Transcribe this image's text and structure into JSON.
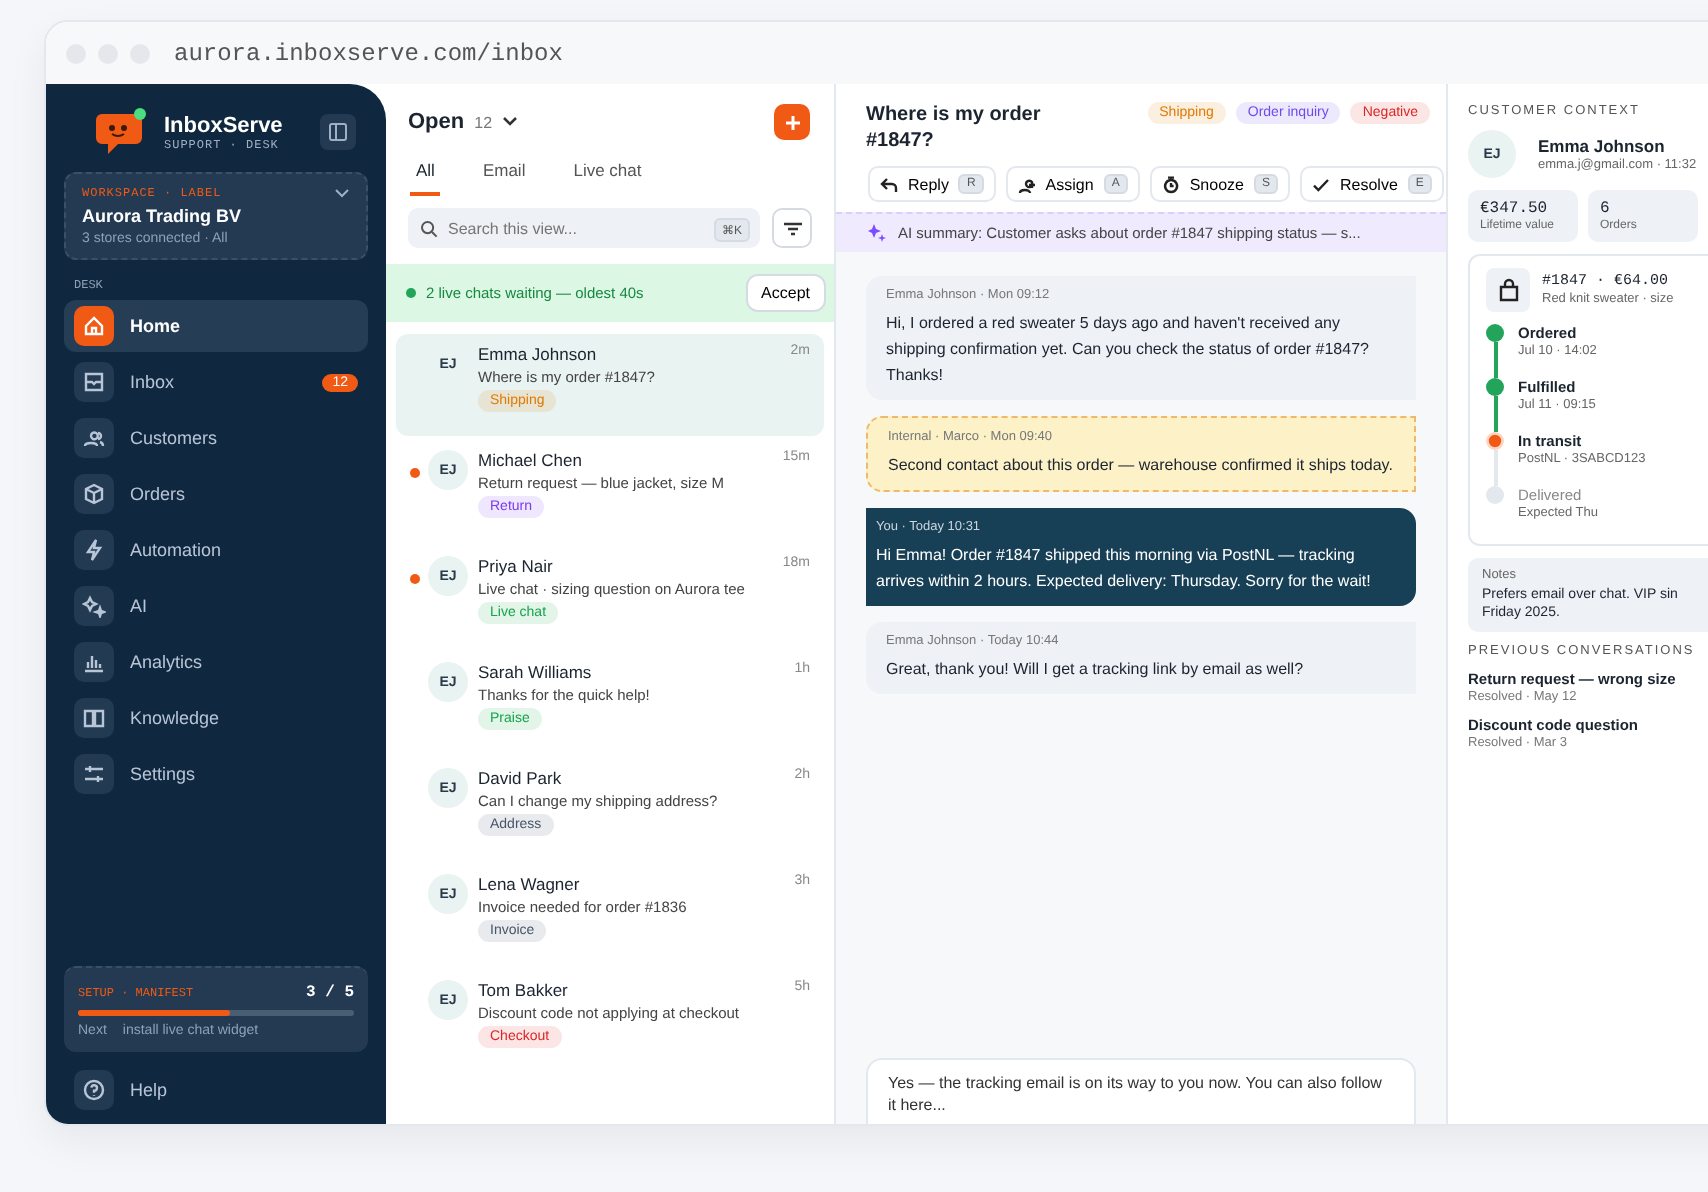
{
  "browser": {
    "url": "aurora.inboxserve.com/inbox"
  },
  "sidebar": {
    "brand": "InboxServe",
    "brand_sub": "SUPPORT · DESK",
    "workspace": {
      "label": "WORKSPACE · LABEL",
      "name": "Aurora Trading BV",
      "detail": "3 stores connected · All"
    },
    "section": "DESK",
    "items": [
      {
        "label": "Home",
        "selected": true
      },
      {
        "label": "Inbox",
        "selected": false,
        "badge": "12"
      },
      {
        "label": "Customers",
        "selected": false
      },
      {
        "label": "Orders",
        "selected": false
      },
      {
        "label": "Automation",
        "selected": false
      },
      {
        "label": "AI",
        "selected": false
      },
      {
        "label": "Analytics",
        "selected": false
      },
      {
        "label": "Knowledge",
        "selected": false
      },
      {
        "label": "Settings",
        "selected": false
      }
    ],
    "setup": {
      "label": "SETUP · MANIFEST",
      "count": "3 / 5",
      "level": 0.55,
      "next_label": "Next",
      "next": "install live chat widget"
    },
    "help": "Help"
  },
  "list": {
    "title": "Open",
    "count": "12",
    "tabs": [
      {
        "label": "All",
        "selected": true
      },
      {
        "label": "Email",
        "selected": false
      },
      {
        "label": "Live chat",
        "selected": false
      }
    ],
    "search": {
      "placeholder": "Search this view...",
      "shortcut": "⌘K"
    },
    "banner": {
      "text": "2 live chats waiting — oldest 40s",
      "action": "Accept"
    },
    "conversations": [
      {
        "initials": "EJ",
        "name": "Emma Johnson",
        "time": "2m",
        "preview": "Where is my order #1847?",
        "tag": "Shipping",
        "color": "#e07a00",
        "unread": false,
        "selected": true
      },
      {
        "initials": "EJ",
        "name": "Michael Chen",
        "time": "15m",
        "preview": "Return request — blue jacket, size M",
        "tag": "Return",
        "color": "#7c3aed",
        "unread": true,
        "selected": false
      },
      {
        "initials": "EJ",
        "name": "Priya Nair",
        "time": "18m",
        "preview": "Live chat · sizing question on Aurora tee",
        "tag": "Live chat",
        "color": "#16a34a",
        "unread": true,
        "selected": false
      },
      {
        "initials": "EJ",
        "name": "Sarah Williams",
        "time": "1h",
        "preview": "Thanks for the quick help!",
        "tag": "Praise",
        "color": "#16a34a",
        "unread": false,
        "selected": false
      },
      {
        "initials": "EJ",
        "name": "David Park",
        "time": "2h",
        "preview": "Can I change my shipping address?",
        "tag": "Address",
        "color": "#475569",
        "unread": false,
        "selected": false
      },
      {
        "initials": "EJ",
        "name": "Lena Wagner",
        "time": "3h",
        "preview": "Invoice needed for order #1836",
        "tag": "Invoice",
        "color": "#475569",
        "unread": false,
        "selected": false
      },
      {
        "initials": "EJ",
        "name": "Tom Bakker",
        "time": "5h",
        "preview": "Discount code not applying at checkout",
        "tag": "Checkout",
        "color": "#dc2626",
        "unread": false,
        "selected": false
      }
    ]
  },
  "conversation": {
    "title": "Where is my order #1847?",
    "tags": [
      {
        "label": "Shipping",
        "color": "#e07a00"
      },
      {
        "label": "Order inquiry",
        "color": "#6d4aed"
      },
      {
        "label": "Negative",
        "color": "#dc2626"
      }
    ],
    "actions": [
      {
        "label": "Reply",
        "key": "R"
      },
      {
        "label": "Assign",
        "key": "A"
      },
      {
        "label": "Snooze",
        "key": "S"
      },
      {
        "label": "Resolve",
        "key": "E"
      }
    ],
    "ai_summary": "AI summary: Customer asks about order #1847 shipping status — s...",
    "messages": [
      {
        "kind": "customer",
        "meta": "Emma Johnson · Mon 09:12",
        "text": "Hi, I ordered a red sweater 5 days ago and haven't received any shipping confirmation yet. Can you check the status of order #1847? Thanks!"
      },
      {
        "kind": "internal",
        "meta": "Internal · Marco · Mon 09:40",
        "text": "Second contact about this order — warehouse confirmed it ships today."
      },
      {
        "kind": "agent",
        "meta": "You · Today 10:31",
        "text": "Hi Emma! Order #1847 shipped this morning via PostNL — tracking arrives within 2 hours. Expected delivery: Thursday. Sorry for the wait!"
      },
      {
        "kind": "customer",
        "meta": "Emma Johnson · Today 10:44",
        "text": "Great, thank you! Will I get a tracking link by email as well?"
      }
    ],
    "composer": {
      "value": "Yes — the tracking email is on its way to you now. You can also follow it here..."
    }
  },
  "context": {
    "heading": "CUSTOMER CONTEXT",
    "initials": "EJ",
    "name": "Emma Johnson",
    "email": "emma.j@gmail.com · 11:32",
    "stats": [
      {
        "value": "€347.50",
        "label": "Lifetime value"
      },
      {
        "value": "6",
        "label": "Orders"
      }
    ],
    "order": {
      "title": "#1847 · €64.00",
      "item": "Red knit sweater · size",
      "steps": [
        {
          "label": "Ordered",
          "detail": "Jul 10 · 14:02",
          "done": true,
          "current": false
        },
        {
          "label": "Fulfilled",
          "detail": "Jul 11 · 09:15",
          "done": true,
          "current": false
        },
        {
          "label": "In transit",
          "detail": "PostNL · 3SABCD123",
          "done": false,
          "current": true
        },
        {
          "label": "Delivered",
          "detail": "Expected Thu",
          "done": false,
          "current": false
        }
      ]
    },
    "notes": {
      "label": "Notes",
      "text": "Prefers email over chat. VIP sin Friday 2025."
    },
    "previous_heading": "PREVIOUS CONVERSATIONS",
    "previous": [
      {
        "title": "Return request — wrong size",
        "detail": "Resolved · May 12"
      },
      {
        "title": "Discount code question",
        "detail": "Resolved · Mar 3"
      }
    ]
  }
}
